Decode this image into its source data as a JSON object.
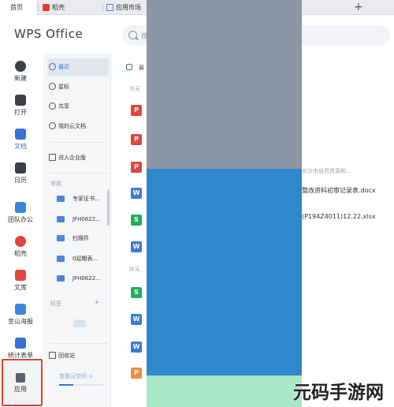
{
  "tabs": {
    "home": "首页",
    "tab2": "稻壳",
    "tab3": "应用市场",
    "new_tab": "+"
  },
  "header": {
    "logo": "WPS Office",
    "search_placeholder": "搜"
  },
  "rail": {
    "items": [
      "新建",
      "打开",
      "文档",
      "日历",
      "团队办公",
      "稻壳",
      "文库",
      "金山海报",
      "统计表单",
      "应用"
    ],
    "active": "文档"
  },
  "col2": {
    "nav": [
      "最近",
      "星标",
      "共享",
      "我的云文档"
    ],
    "enterprise": "进入企业版",
    "frequent_label": "常用",
    "frequent": [
      "专家证书...",
      "JFH0622...",
      "扫描件",
      "0延期表...",
      "JFH0622..."
    ],
    "tags_label": "标签",
    "tags_add": "+",
    "recycle": "回收站",
    "space_link": "查看云空间 >"
  },
  "main": {
    "filter_label": "最",
    "today_label": "今天",
    "yesterday_label": "昨天",
    "rows": [
      {
        "icon": "P",
        "color": "#e2453c"
      },
      {
        "icon": "P",
        "color": "#e2453c"
      },
      {
        "icon": "P",
        "color": "#e2453c"
      },
      {
        "icon": "W",
        "color": "#3a7fd5"
      },
      {
        "icon": "S",
        "color": "#1fae5c"
      },
      {
        "icon": "W",
        "color": "#3a7fd5"
      },
      {
        "icon": "S",
        "color": "#1fae5c"
      },
      {
        "icon": "W",
        "color": "#3a7fd5"
      },
      {
        "icon": "W",
        "color": "#3a7fd5"
      },
      {
        "icon": "P",
        "color": "#f08a45"
      }
    ],
    "visible_meta": "长沙市自然资源和...",
    "visible_doc1": "整改资料初审记录表.docx",
    "visible_doc2": "(P194Z4011)12.22.xlsx"
  },
  "watermark": "元码手游网"
}
